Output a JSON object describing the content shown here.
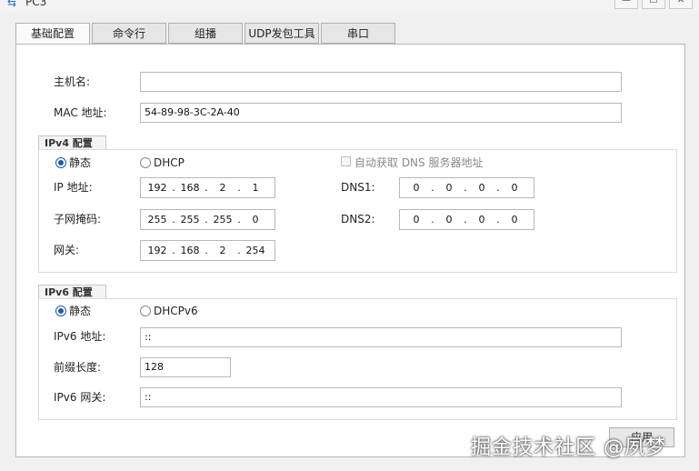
{
  "window": {
    "title": "PC3",
    "minimize": "—",
    "maximize": "☐",
    "close": "✕"
  },
  "tabs": [
    {
      "label": "基础配置"
    },
    {
      "label": "命令行"
    },
    {
      "label": "组播"
    },
    {
      "label": "UDP发包工具"
    },
    {
      "label": "串口"
    }
  ],
  "basic": {
    "hostname_label": "主机名:",
    "hostname_value": "",
    "mac_label": "MAC 地址:",
    "mac_value": "54-89-98-3C-2A-40"
  },
  "ipv4": {
    "group_label": "IPv4 配置",
    "static_label": "静态",
    "dhcp_label": "DHCP",
    "auto_dns_label": "自动获取 DNS 服务器地址",
    "ip_label": "IP 地址:",
    "ip": [
      "192",
      "168",
      "2",
      "1"
    ],
    "mask_label": "子网掩码:",
    "mask": [
      "255",
      "255",
      "255",
      "0"
    ],
    "gateway_label": "网关:",
    "gateway": [
      "192",
      "168",
      "2",
      "254"
    ],
    "dns1_label": "DNS1:",
    "dns1": [
      "0",
      "0",
      "0",
      "0"
    ],
    "dns2_label": "DNS2:",
    "dns2": [
      "0",
      "0",
      "0",
      "0"
    ]
  },
  "ipv6": {
    "group_label": "IPv6 配置",
    "static_label": "静态",
    "dhcp_label": "DHCPv6",
    "addr_label": "IPv6 地址:",
    "addr_value": "::",
    "prefix_label": "前缀长度:",
    "prefix_value": "128",
    "gateway_label": "IPv6 网关:",
    "gateway_value": "::"
  },
  "apply_label": "应用",
  "watermark": "掘金技术社区 @夙梦"
}
